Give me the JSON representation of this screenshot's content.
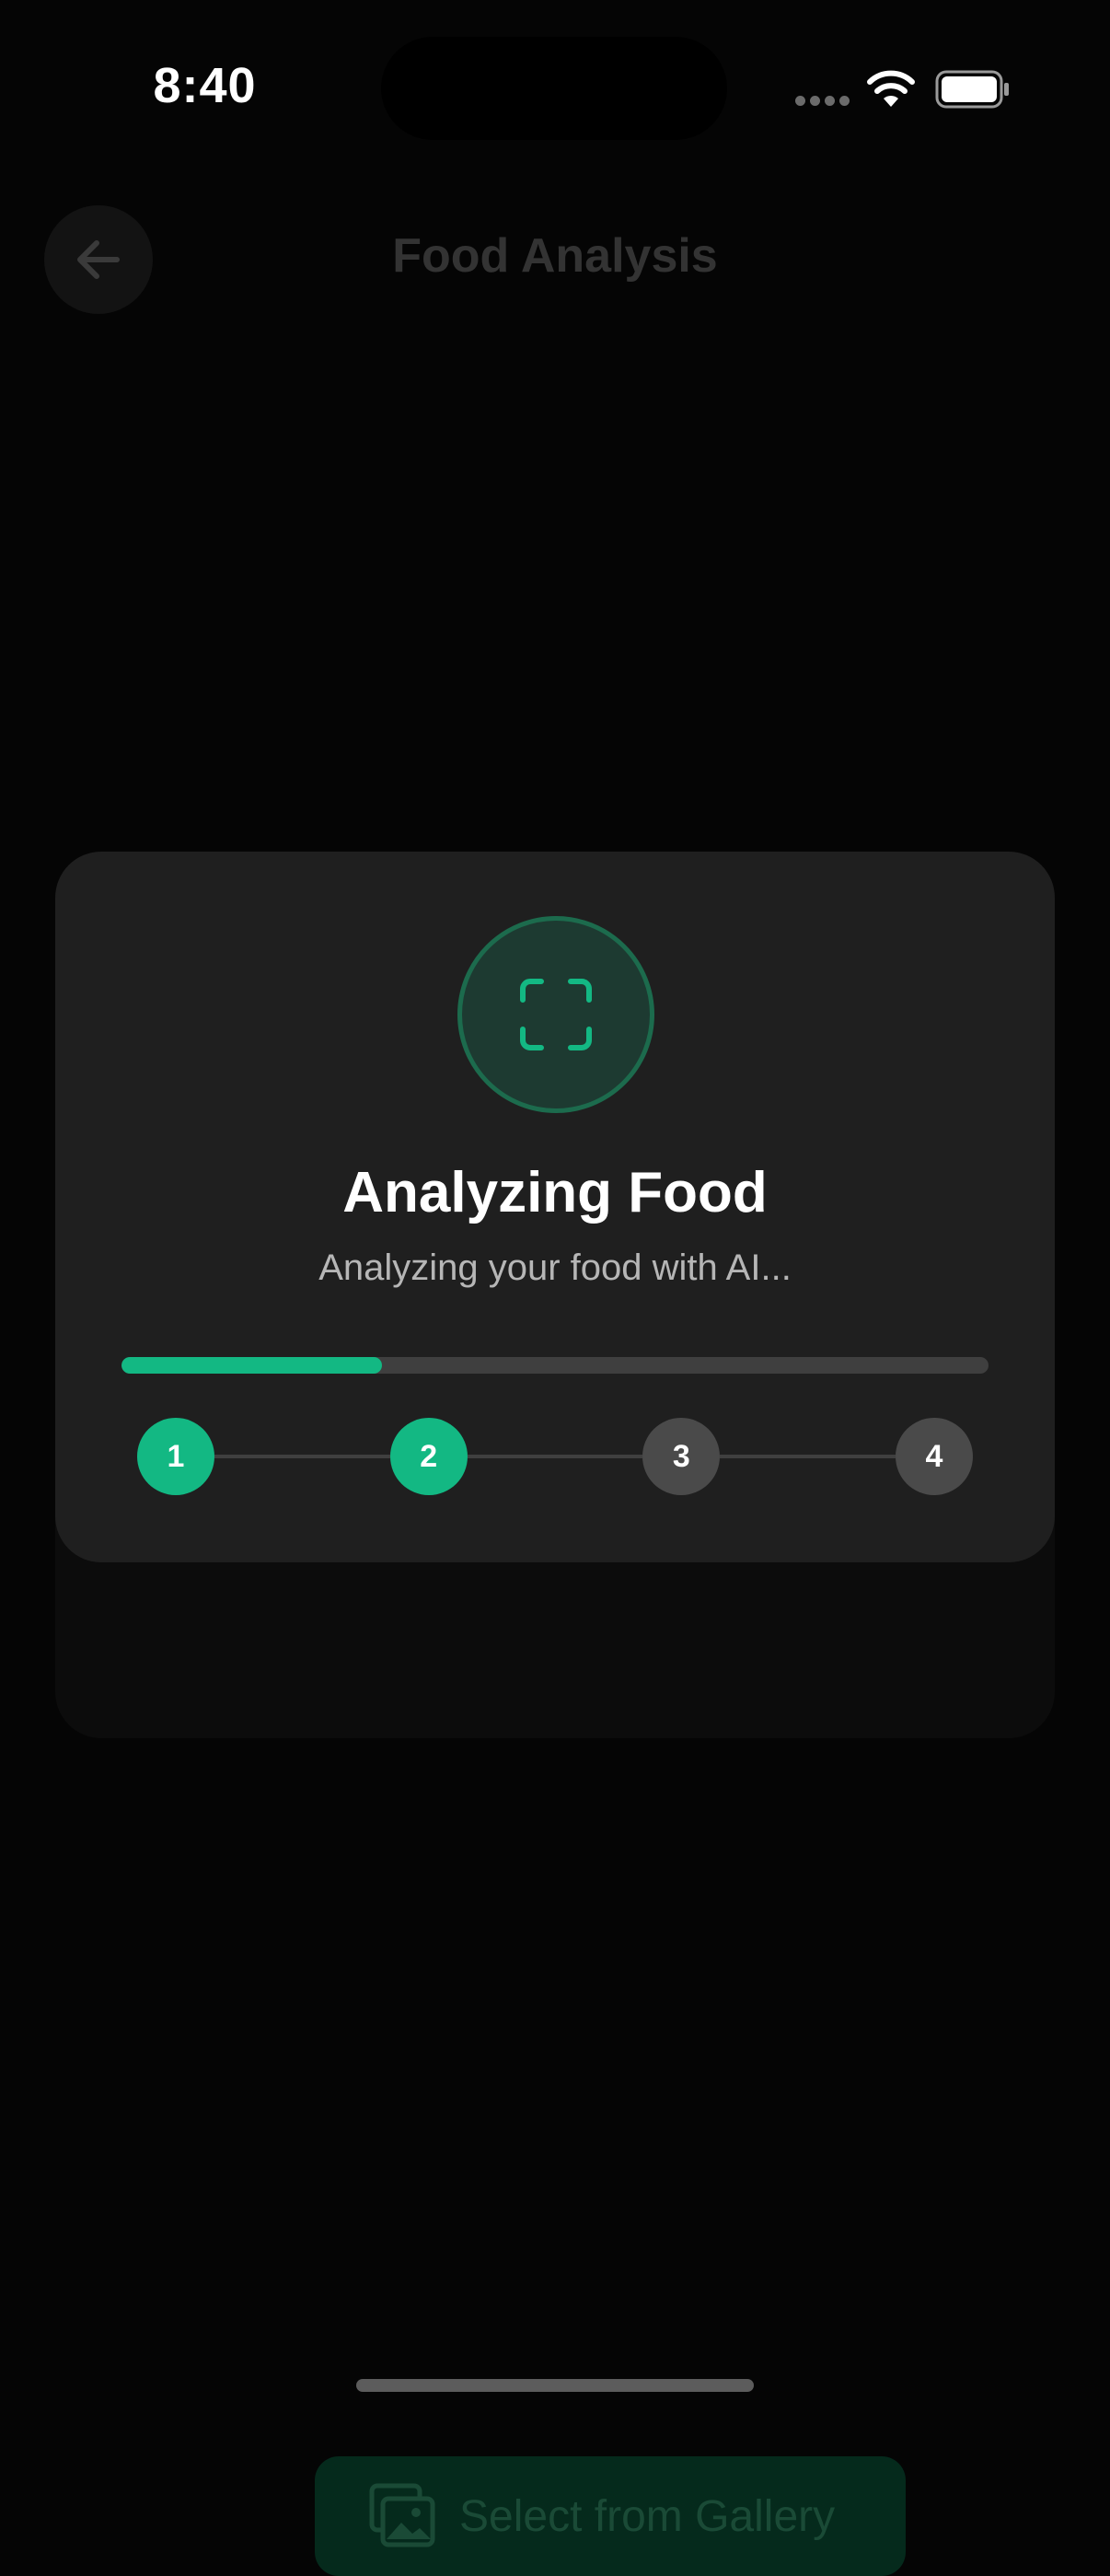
{
  "status_bar": {
    "time": "8:40",
    "signal_icon": "cellular-dots-icon",
    "wifi_icon": "wifi-icon",
    "battery_icon": "battery-icon"
  },
  "header": {
    "title": "Food Analysis",
    "back_icon": "arrow-left-icon"
  },
  "background_card": {
    "gallery_button_label": "Select from Gallery",
    "gallery_icon": "photo-gallery-icon"
  },
  "modal": {
    "icon": "scan-frame-icon",
    "title": "Analyzing Food",
    "subtitle": "Analyzing your food with AI...",
    "progress_fraction": 0.3,
    "steps": [
      {
        "label": "1",
        "done": true
      },
      {
        "label": "2",
        "done": true
      },
      {
        "label": "3",
        "done": false
      },
      {
        "label": "4",
        "done": false
      }
    ],
    "accent_color": "#13b883"
  }
}
